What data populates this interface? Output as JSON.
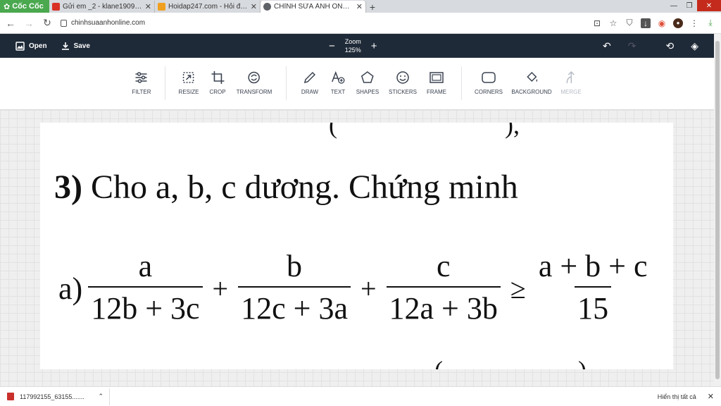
{
  "browser": {
    "brand": "Cốc Cốc",
    "tabs": [
      {
        "title": "Gửi em _2 - klane190905@gm",
        "icon": "gmail-icon",
        "color": "#d93025"
      },
      {
        "title": "Hoidap247.com - Hỏi đáp bài",
        "icon": "hoidap-icon",
        "color": "#f0a020"
      },
      {
        "title": "CHỈNH SỬA ẢNH ONLINE - P",
        "icon": "globe-icon",
        "color": "#5f6368"
      }
    ],
    "url": "chinhsuaanhonline.com"
  },
  "app": {
    "open_label": "Open",
    "save_label": "Save",
    "zoom_label": "Zoom",
    "zoom_value": "125%",
    "tools": {
      "filter": "FILTER",
      "resize": "RESIZE",
      "crop": "CROP",
      "transform": "TRANSFORM",
      "draw": "DRAW",
      "text": "TEXT",
      "shapes": "SHAPES",
      "stickers": "STICKERS",
      "frame": "FRAME",
      "corners": "CORNERS",
      "background": "BACKGROUND",
      "merge": "MERGE"
    }
  },
  "image": {
    "top_fragment": "(",
    "top_fragment2": "),",
    "heading_num": "3)",
    "heading_text": "Cho a, b, c dương. Chứng minh",
    "eq_prefix": "a)",
    "f1_num": "a",
    "f1_den": "12b + 3c",
    "op1": "+",
    "f2_num": "b",
    "f2_den": "12c + 3a",
    "op2": "+",
    "f3_num": "c",
    "f3_den": "12a + 3b",
    "op3": "≥",
    "f4_num": "a + b + c",
    "f4_den": "15",
    "bottom_fragment": "(",
    "bottom_fragment2": ")"
  },
  "downloads": {
    "file": "117992155_63155.......",
    "show_all": "Hiển thị tất cả"
  }
}
